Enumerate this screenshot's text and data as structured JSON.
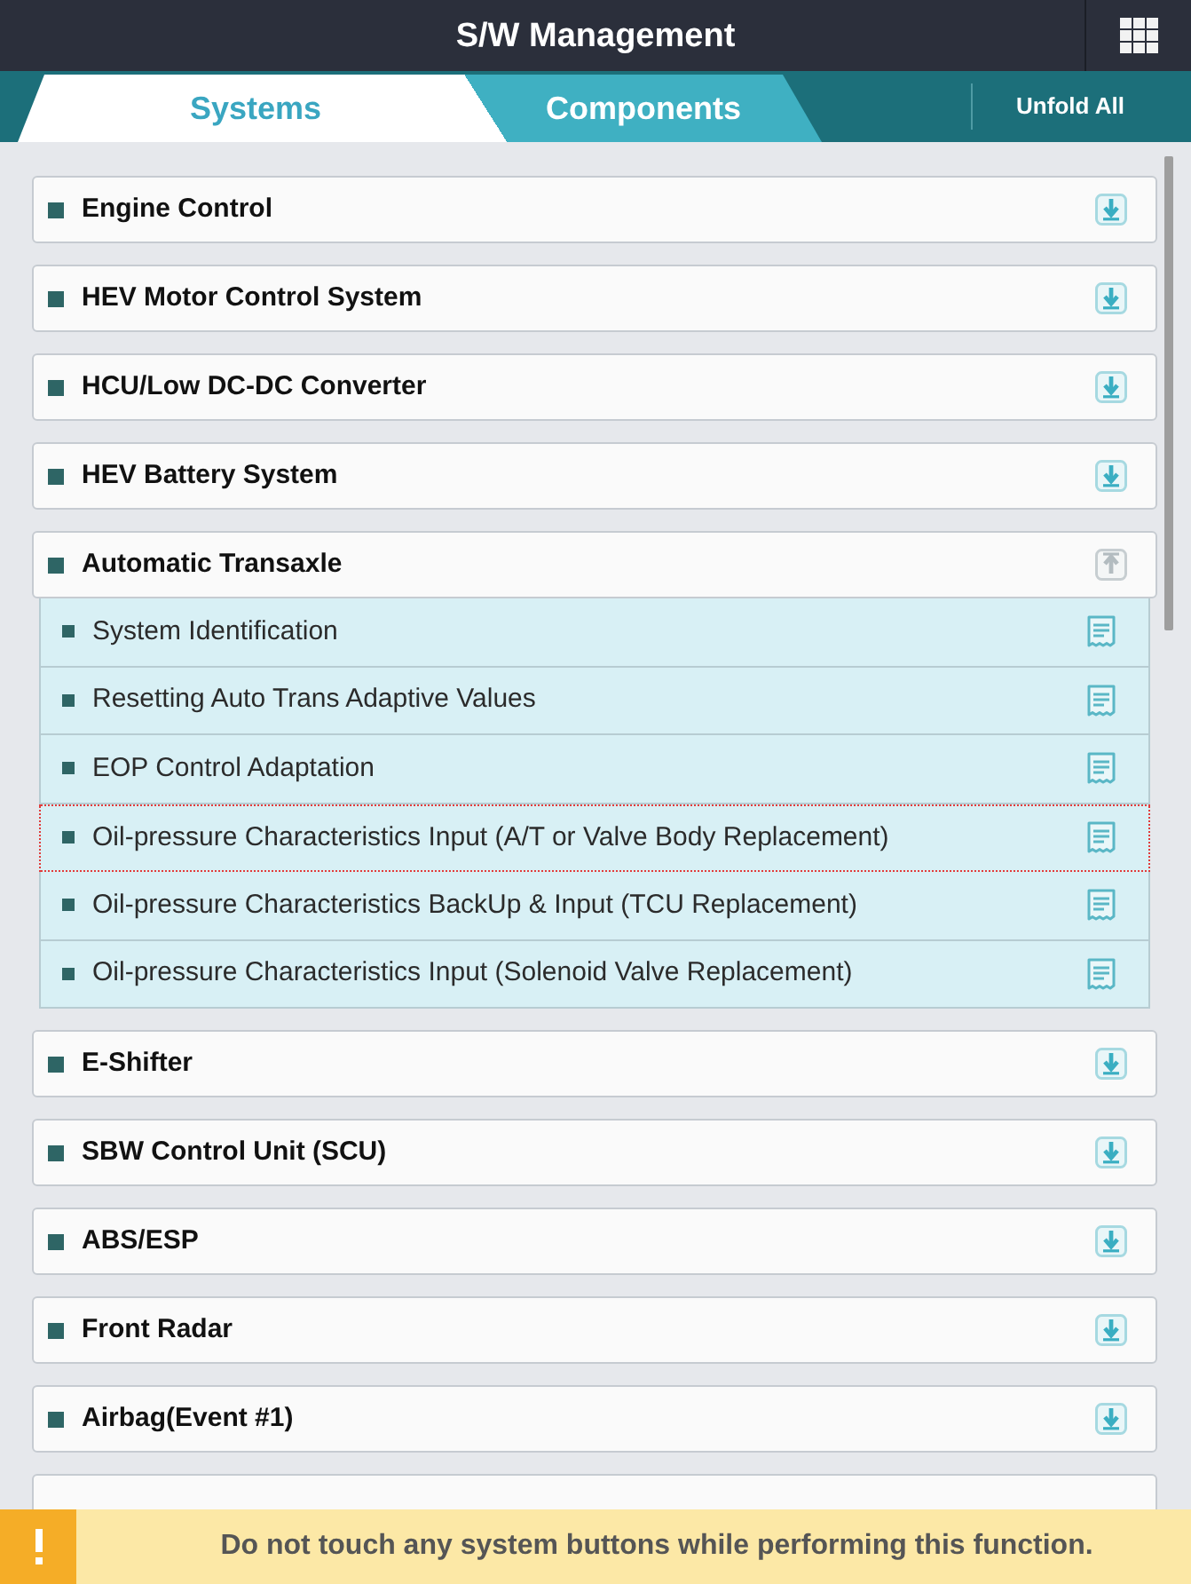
{
  "header": {
    "title": "S/W Management"
  },
  "tabs": [
    {
      "label": "Systems",
      "selected": true
    },
    {
      "label": "Components",
      "selected": false
    }
  ],
  "toolbar": {
    "unfold_all": "Unfold All"
  },
  "systems": [
    {
      "name": "Engine Control",
      "expanded": false
    },
    {
      "name": "HEV Motor Control System",
      "expanded": false
    },
    {
      "name": "HCU/Low DC-DC Converter",
      "expanded": false
    },
    {
      "name": "HEV Battery System",
      "expanded": false
    },
    {
      "name": "Automatic Transaxle",
      "expanded": true,
      "children": [
        {
          "name": "System Identification",
          "selected": false
        },
        {
          "name": "Resetting Auto Trans Adaptive Values",
          "selected": false
        },
        {
          "name": "EOP Control Adaptation",
          "selected": false
        },
        {
          "name": "Oil-pressure Characteristics Input (A/T or Valve Body Replacement)",
          "selected": true
        },
        {
          "name": "Oil-pressure Characteristics BackUp & Input (TCU Replacement)",
          "selected": false
        },
        {
          "name": "Oil-pressure Characteristics Input (Solenoid Valve Replacement)",
          "selected": false
        }
      ]
    },
    {
      "name": "E-Shifter",
      "expanded": false
    },
    {
      "name": "SBW Control Unit (SCU)",
      "expanded": false
    },
    {
      "name": "ABS/ESP",
      "expanded": false
    },
    {
      "name": "Front Radar",
      "expanded": false
    },
    {
      "name": "Airbag(Event #1)",
      "expanded": false
    }
  ],
  "warning": {
    "message": "Do not touch any system buttons while performing this function."
  }
}
